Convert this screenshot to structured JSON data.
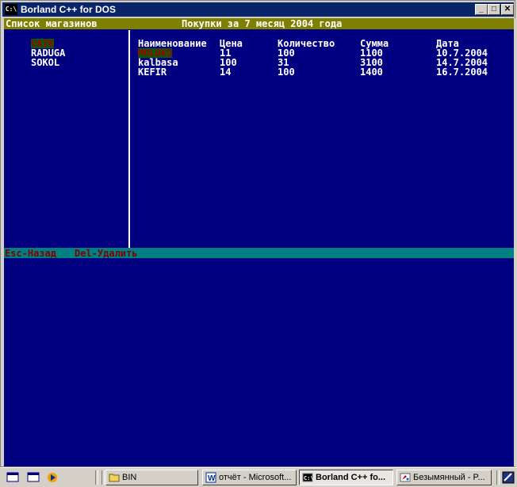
{
  "window": {
    "title": "Borland C++ for DOS",
    "icon_label": "C:\\",
    "buttons": {
      "minimize": "_",
      "maximize": "□",
      "close": "✕"
    }
  },
  "console": {
    "left_header": "Список магазинов",
    "center_header": "Покупки за 7 месяц 2004 года",
    "stores": [
      "VAIK",
      "RADUGA",
      "SOKOL"
    ],
    "selected_store_index": 0,
    "columns": [
      "Наименование",
      "Цена",
      "Количество",
      "Сумма",
      "Дата"
    ],
    "rows": [
      [
        "MOLOKO",
        "11",
        "100",
        "1100",
        "10.7.2004"
      ],
      [
        "kalbasa",
        "100",
        "31",
        "3100",
        "14.7.2004"
      ],
      [
        "KEFIR",
        "14",
        "100",
        "1400",
        "16.7.2004"
      ]
    ],
    "selected_row_index": 0,
    "footer_esc": "Esc-Назад",
    "footer_del": "Del-Удалить"
  },
  "taskbar": {
    "buttons": [
      {
        "label": "BIN",
        "icon": "folder-icon"
      },
      {
        "label": "отчёт - Microsoft...",
        "icon": "word-icon"
      },
      {
        "label": "Borland C++ fo...",
        "icon": "dos-icon",
        "active": true
      },
      {
        "label": "Безымянный - P...",
        "icon": "paint-icon"
      }
    ]
  },
  "colors": {
    "console_bg": "#000080",
    "header_bar": "#808000",
    "footer_bar": "#008080",
    "footer_text": "#800000",
    "selection_bg": "#006000",
    "selection_text": "#a00000"
  }
}
